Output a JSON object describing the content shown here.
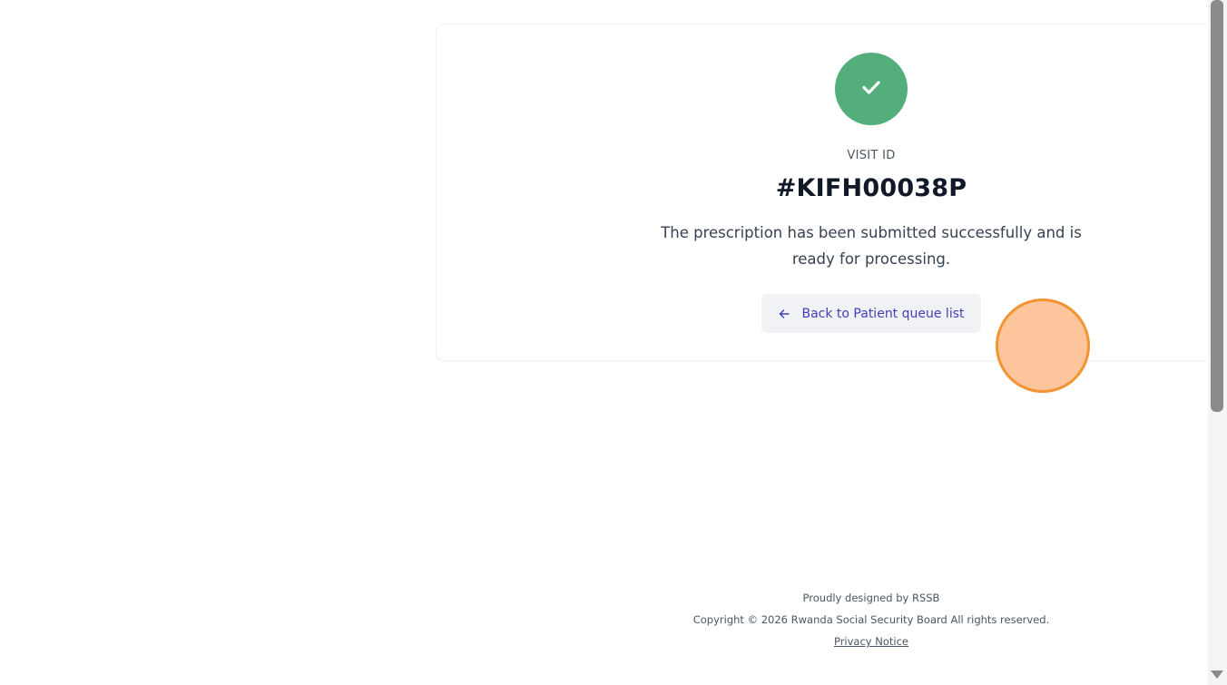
{
  "colors": {
    "success": "#53ae7b",
    "accent": "#3f3fb5",
    "button_bg": "#f1f2f6",
    "cursor_fill": "#fdc59b",
    "cursor_ring": "#f39331"
  },
  "confirmation": {
    "icon": "check-icon",
    "visit_label": "VISIT ID",
    "visit_id": "#KIFH00038P",
    "message": "The prescription has been submitted successfully and is ready for processing.",
    "back_button": {
      "icon": "arrow-left-icon",
      "label": "Back to Patient queue list"
    }
  },
  "footer": {
    "designed_by": "Proudly designed by RSSB",
    "copyright": "Copyright © 2026 Rwanda Social Security Board All rights reserved.",
    "privacy_link": "Privacy Notice"
  }
}
